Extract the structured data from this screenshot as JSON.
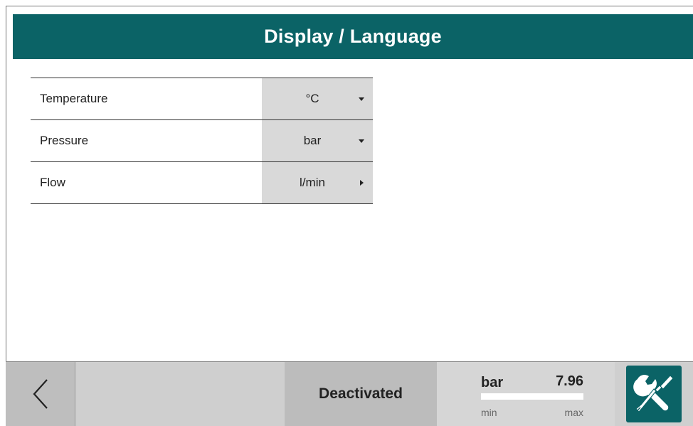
{
  "header": {
    "title": "Display / Language"
  },
  "settings": [
    {
      "label": "Temperature",
      "value": "°C",
      "arrow": "down"
    },
    {
      "label": "Pressure",
      "value": "bar",
      "arrow": "down"
    },
    {
      "label": "Flow",
      "value": "l/min",
      "arrow": "right"
    }
  ],
  "footer": {
    "back_icon": "chevron-left-icon",
    "status": "Deactivated",
    "gauge": {
      "unit": "bar",
      "value": "7.96",
      "min_label": "min",
      "max_label": "max",
      "fill_fraction": 1.0
    },
    "tools_icon": "wrench-screwdriver-icon"
  },
  "colors": {
    "accent": "#0b6366",
    "select_bg": "#d9d9d9",
    "footer_bg": "#cfcfcf"
  }
}
